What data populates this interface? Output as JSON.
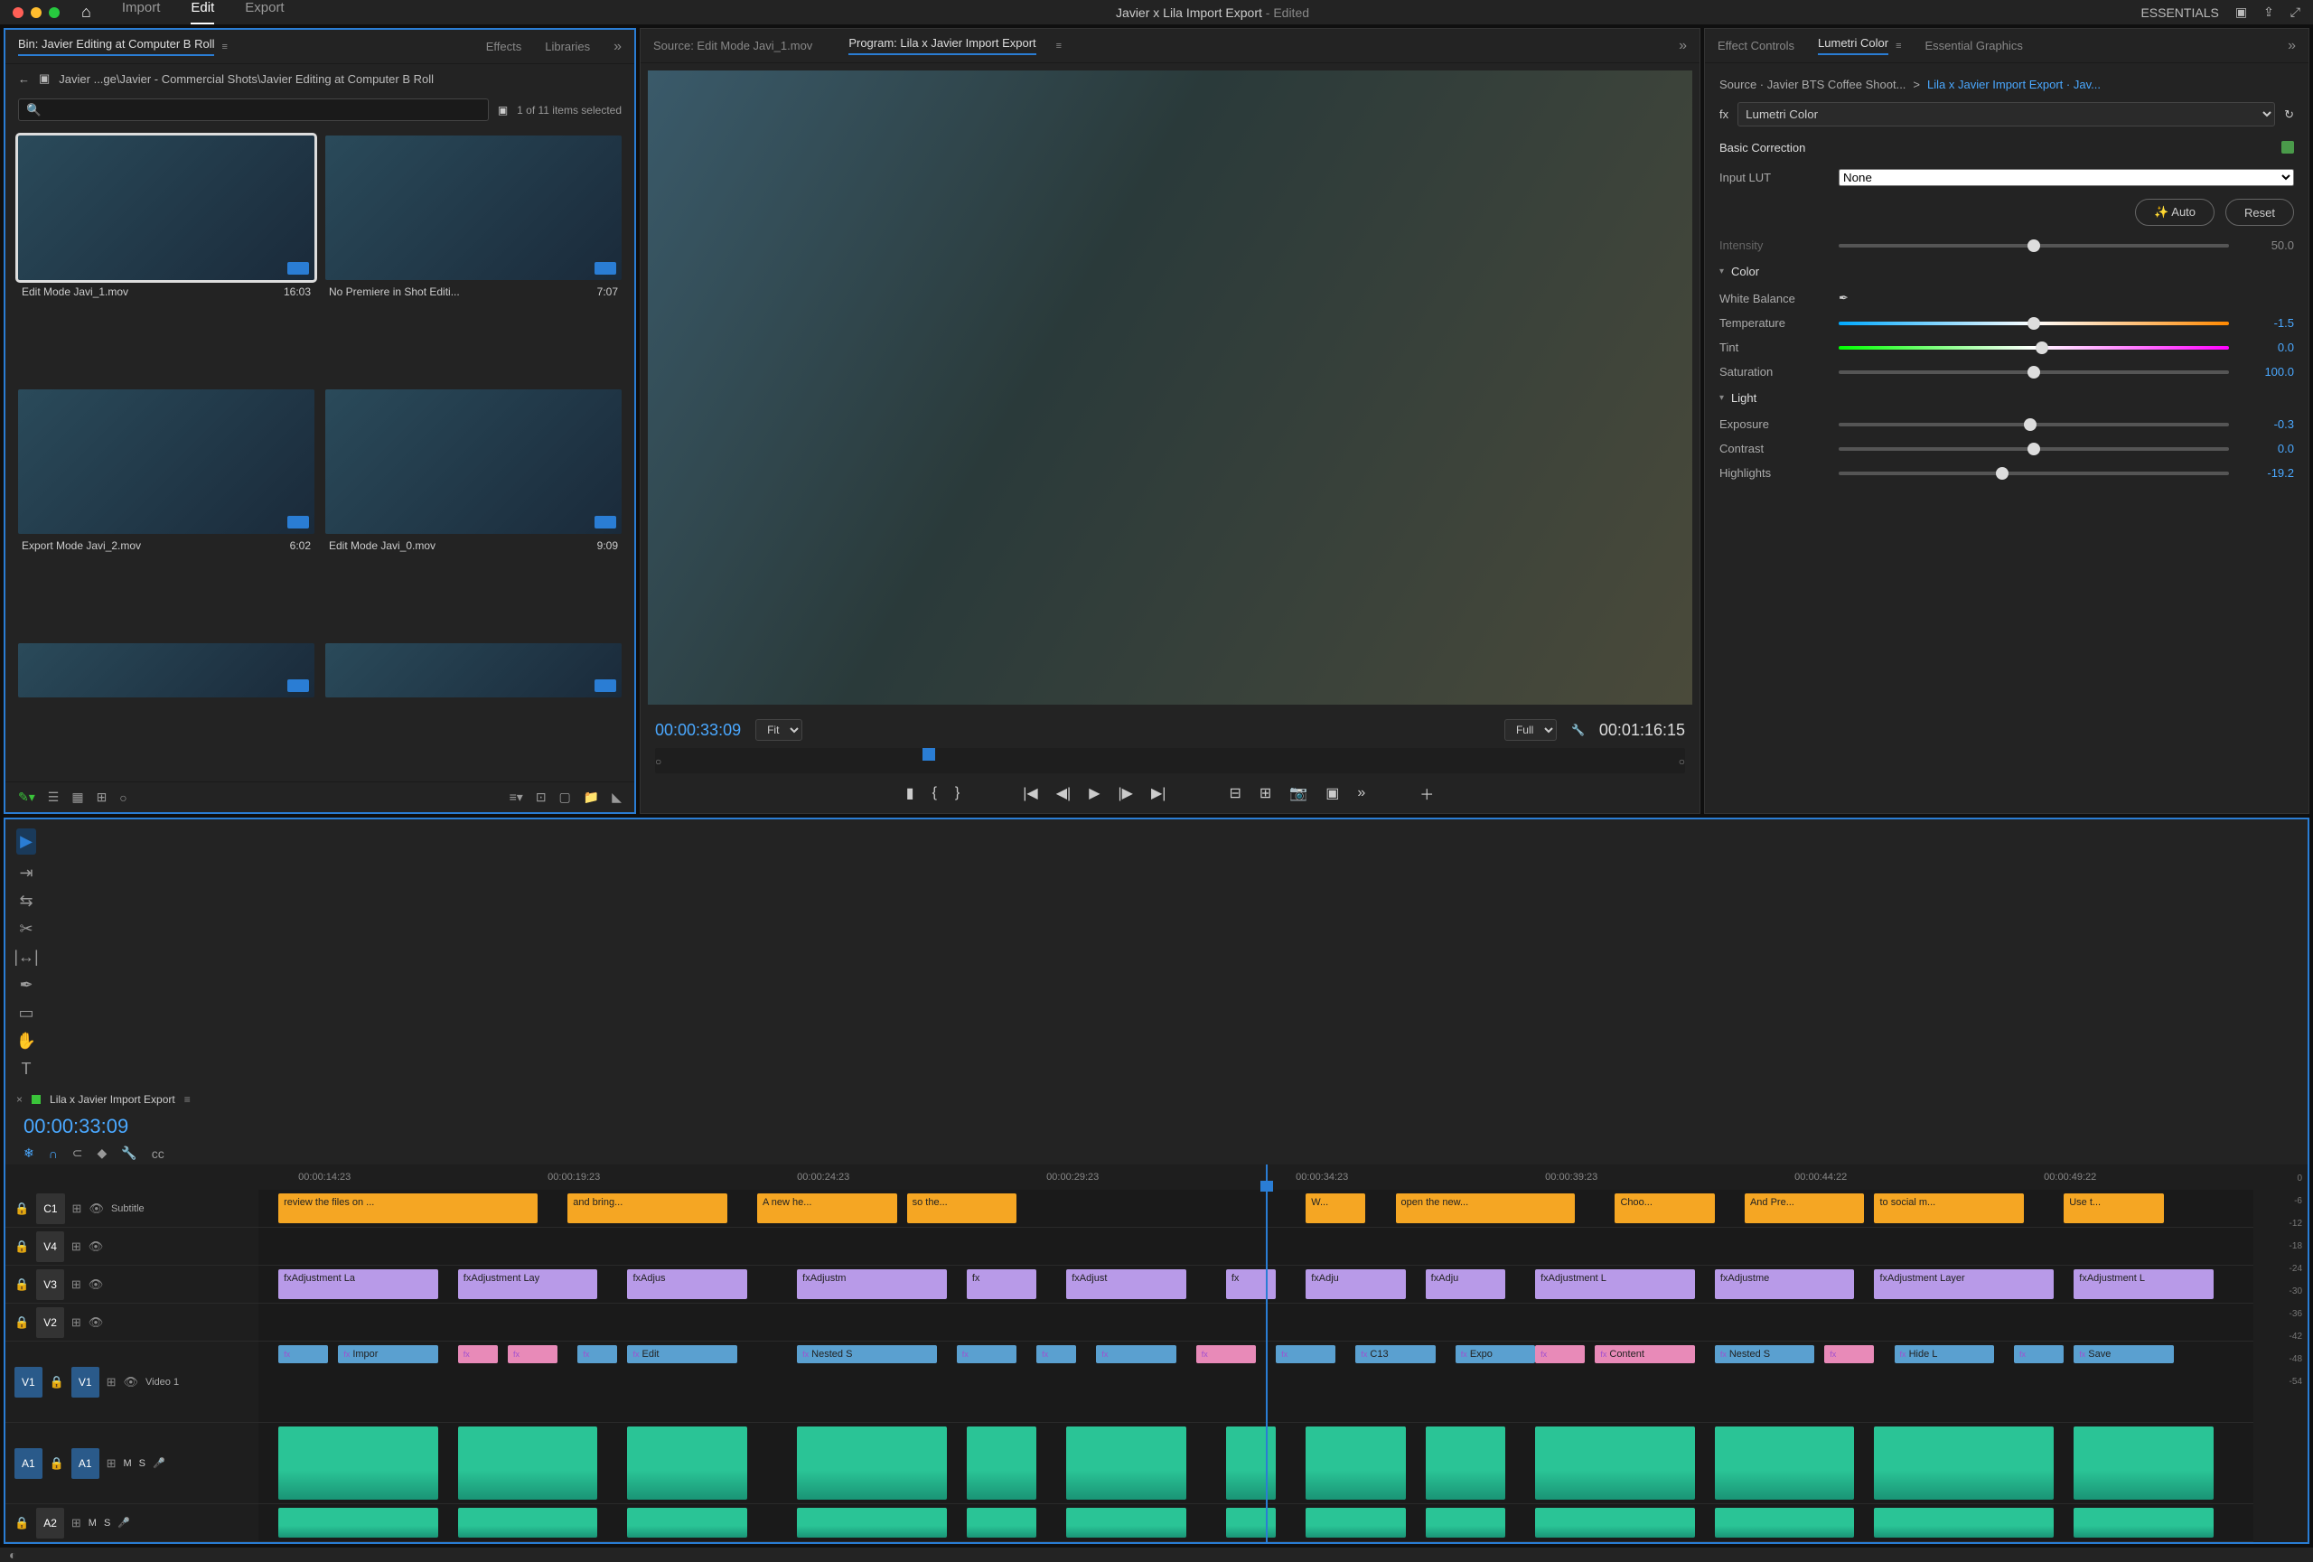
{
  "topbar": {
    "nav": [
      "Import",
      "Edit",
      "Export"
    ],
    "active_nav": "Edit",
    "title": "Javier x Lila Import Export",
    "edited": " - Edited",
    "workspace": "ESSENTIALS"
  },
  "project": {
    "tabs": [
      "Bin: Javier Editing at Computer B Roll",
      "Effects",
      "Libraries"
    ],
    "breadcrumb": "Javier ...ge\\Javier - Commercial Shots\\Javier Editing at Computer B Roll",
    "stats": "1 of 11 items selected",
    "clips": [
      {
        "name": "Edit Mode Javi_1.mov",
        "dur": "16:03",
        "selected": true
      },
      {
        "name": "No Premiere in Shot Editi...",
        "dur": "7:07"
      },
      {
        "name": "Export Mode Javi_2.mov",
        "dur": "6:02"
      },
      {
        "name": "Edit Mode Javi_0.mov",
        "dur": "9:09"
      }
    ]
  },
  "monitor": {
    "source_tab": "Source: Edit Mode Javi_1.mov",
    "program_tab": "Program: Lila x Javier Import Export",
    "tc_in": "00:00:33:09",
    "tc_out": "00:01:16:15",
    "zoom_left": "Fit",
    "zoom_right": "Full"
  },
  "lumetri": {
    "tabs": [
      "Effect Controls",
      "Lumetri Color",
      "Essential Graphics"
    ],
    "source": "Source · Javier BTS Coffee Shoot...",
    "target": "Lila x Javier Import Export · Jav...",
    "effect": "Lumetri Color",
    "basic": "Basic Correction",
    "input_lut_label": "Input LUT",
    "input_lut": "None",
    "auto": "Auto",
    "reset": "Reset",
    "intensity_label": "Intensity",
    "intensity": "50.0",
    "color_hdr": "Color",
    "wb_label": "White Balance",
    "params": [
      {
        "label": "Temperature",
        "val": "-1.5",
        "pos": 50,
        "cls": "temp"
      },
      {
        "label": "Tint",
        "val": "0.0",
        "pos": 52,
        "cls": "tint"
      },
      {
        "label": "Saturation",
        "val": "100.0",
        "pos": 50,
        "cls": ""
      }
    ],
    "light_hdr": "Light",
    "light": [
      {
        "label": "Exposure",
        "val": "-0.3",
        "pos": 49
      },
      {
        "label": "Contrast",
        "val": "0.0",
        "pos": 50
      },
      {
        "label": "Highlights",
        "val": "-19.2",
        "pos": 42
      }
    ]
  },
  "timeline": {
    "seq_name": "Lila x Javier Import Export",
    "tc": "00:00:33:09",
    "ruler": [
      "00:00:14:23",
      "00:00:19:23",
      "00:00:24:23",
      "00:00:29:23",
      "00:00:34:23",
      "00:00:39:23",
      "00:00:44:22",
      "00:00:49:22"
    ],
    "tracks": {
      "c1": "Subtitle",
      "v4": "",
      "v3": "",
      "v2": "",
      "v1": "Video 1",
      "a1": "",
      "a2": ""
    },
    "subtitles": [
      {
        "l": 1,
        "w": 13,
        "t": "review the files on ..."
      },
      {
        "l": 15.5,
        "w": 8,
        "t": "and bring..."
      },
      {
        "l": 25,
        "w": 7,
        "t": "A new he..."
      },
      {
        "l": 32.5,
        "w": 5.5,
        "t": "so the..."
      },
      {
        "l": 52.5,
        "w": 3,
        "t": "W..."
      },
      {
        "l": 57,
        "w": 9,
        "t": "open the new..."
      },
      {
        "l": 68,
        "w": 5,
        "t": "Choo..."
      },
      {
        "l": 74.5,
        "w": 6,
        "t": "And Pre..."
      },
      {
        "l": 81,
        "w": 7.5,
        "t": "to social m..."
      },
      {
        "l": 90.5,
        "w": 5,
        "t": "Use t..."
      }
    ],
    "adjust": [
      {
        "l": 1,
        "w": 8,
        "t": "Adjustment La"
      },
      {
        "l": 10,
        "w": 7,
        "t": "Adjustment Lay"
      },
      {
        "l": 18.5,
        "w": 6,
        "t": "Adjus"
      },
      {
        "l": 27,
        "w": 7.5,
        "t": "Adjustm"
      },
      {
        "l": 35.5,
        "w": 3.5,
        "t": ""
      },
      {
        "l": 40.5,
        "w": 6,
        "t": "Adjust"
      },
      {
        "l": 48.5,
        "w": 2.5,
        "t": ""
      },
      {
        "l": 52.5,
        "w": 5,
        "t": "Adju"
      },
      {
        "l": 58.5,
        "w": 4,
        "t": "Adju"
      },
      {
        "l": 64,
        "w": 8,
        "t": "Adjustment L"
      },
      {
        "l": 73,
        "w": 7,
        "t": "Adjustme"
      },
      {
        "l": 81,
        "w": 9,
        "t": "Adjustment Layer"
      },
      {
        "l": 91,
        "w": 7,
        "t": "Adjustment L"
      }
    ],
    "video": [
      {
        "l": 1,
        "w": 2.5,
        "t": ""
      },
      {
        "l": 4,
        "w": 5,
        "t": "Impor"
      },
      {
        "l": 10,
        "w": 2,
        "t": "",
        "pink": true
      },
      {
        "l": 12.5,
        "w": 2.5,
        "t": "",
        "pink": true
      },
      {
        "l": 16,
        "w": 2,
        "t": ""
      },
      {
        "l": 18.5,
        "w": 5.5,
        "t": "Edit"
      },
      {
        "l": 27,
        "w": 7,
        "t": "Nested S"
      },
      {
        "l": 35,
        "w": 3,
        "t": ""
      },
      {
        "l": 39,
        "w": 2,
        "t": ""
      },
      {
        "l": 42,
        "w": 4,
        "t": ""
      },
      {
        "l": 47,
        "w": 3,
        "t": "",
        "pink": true
      },
      {
        "l": 51,
        "w": 3,
        "t": ""
      },
      {
        "l": 55,
        "w": 4,
        "t": "C13"
      },
      {
        "l": 60,
        "w": 4,
        "t": "Expo"
      },
      {
        "l": 64,
        "w": 2.5,
        "t": "",
        "pink": true
      },
      {
        "l": 67,
        "w": 5,
        "t": "Content",
        "pink": true
      },
      {
        "l": 73,
        "w": 5,
        "t": "Nested S"
      },
      {
        "l": 78.5,
        "w": 2.5,
        "t": "",
        "pink": true
      },
      {
        "l": 82,
        "w": 5,
        "t": "Hide L"
      },
      {
        "l": 88,
        "w": 2.5,
        "t": ""
      },
      {
        "l": 91,
        "w": 5,
        "t": "Save"
      }
    ],
    "meters": [
      "0",
      "-6",
      "-12",
      "-18",
      "-24",
      "-30",
      "-36",
      "-42",
      "-48",
      "-54"
    ]
  }
}
